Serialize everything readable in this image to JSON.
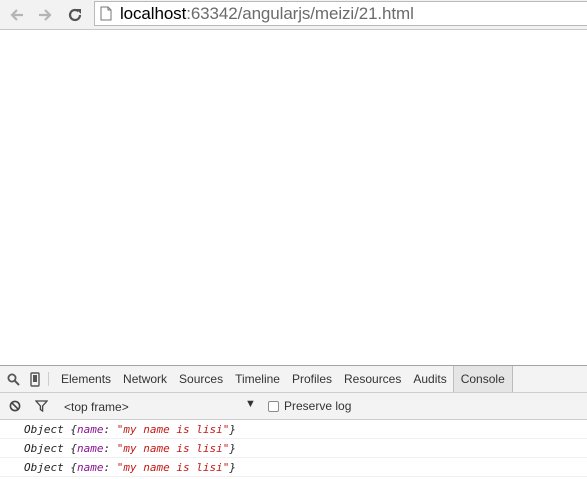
{
  "browser": {
    "url_host": "localhost",
    "url_rest": ":63342/angularjs/meizi/21.html",
    "icons": {
      "back": "back-arrow-icon",
      "forward": "forward-arrow-icon",
      "reload": "reload-icon",
      "page": "page-icon"
    }
  },
  "devtools": {
    "tabs": [
      "Elements",
      "Network",
      "Sources",
      "Timeline",
      "Profiles",
      "Resources",
      "Audits",
      "Console"
    ],
    "selected_tab": "Console",
    "frame_select": "<top frame>",
    "preserve_log_label": "Preserve log",
    "preserve_log_checked": false,
    "console_lines": [
      {
        "type": "Object",
        "open": "{",
        "key": "name",
        "colon": ":",
        "value": "\"my name is lisi\"",
        "close": "}"
      },
      {
        "type": "Object",
        "open": "{",
        "key": "name",
        "colon": ":",
        "value": "\"my name is lisi\"",
        "close": "}"
      },
      {
        "type": "Object",
        "open": "{",
        "key": "name",
        "colon": ":",
        "value": "\"my name is lisi\"",
        "close": "}"
      }
    ]
  }
}
